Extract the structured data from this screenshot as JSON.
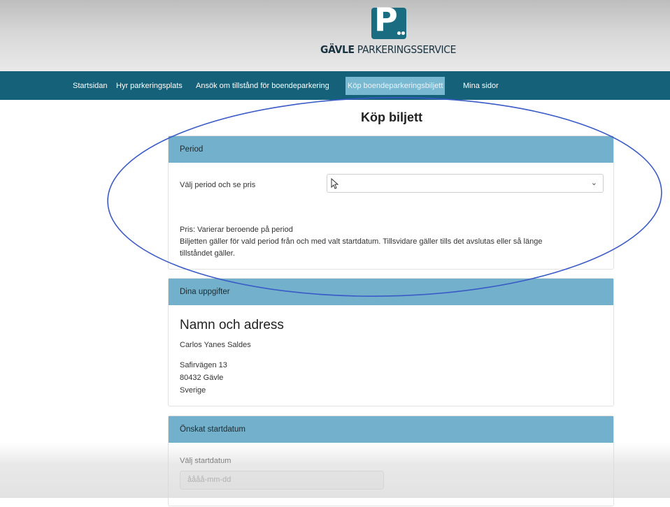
{
  "brand": {
    "logo_letter": "P",
    "name_bold": "GÄVLE",
    "name_rest": " PARKERINGSSERVICE"
  },
  "nav": {
    "items": [
      {
        "label": "Startsidan"
      },
      {
        "label": "Hyr parkeringsplats"
      },
      {
        "label": "Ansök om tillstånd för boendeparkering"
      },
      {
        "label": "Köp boendeparkeringsbiljett",
        "active": true
      },
      {
        "label": "Mina sidor"
      }
    ],
    "active_color": "#79b8d1",
    "bar_color": "#15617a"
  },
  "page": {
    "title": "Köp biljett"
  },
  "period": {
    "header": "Period",
    "select_label": "Välj period och se pris",
    "select_value": "",
    "price_line": "Pris: Varierar beroende på period",
    "info_line1": "Biljetten gäller för vald period från och med valt startdatum. Tillsvidare gäller tills det avslutas eller så länge",
    "info_line2": "tillståndet gäller."
  },
  "details": {
    "header": "Dina uppgifter",
    "heading": "Namn och adress",
    "name": "Carlos Yanes Saldes",
    "street": "Safirvägen 13",
    "postal": "80432 Gävle",
    "country": "Sverige"
  },
  "startdate": {
    "header": "Önskat startdatum",
    "label": "Välj startdatum",
    "placeholder": "åååå-mm-dd"
  },
  "colors": {
    "card_header": "#72b0cb",
    "annotation_ellipse": "#3a5bc7"
  },
  "icons": {
    "select_chevron": "chevron-down-icon",
    "cursor": "mouse-pointer-icon"
  }
}
